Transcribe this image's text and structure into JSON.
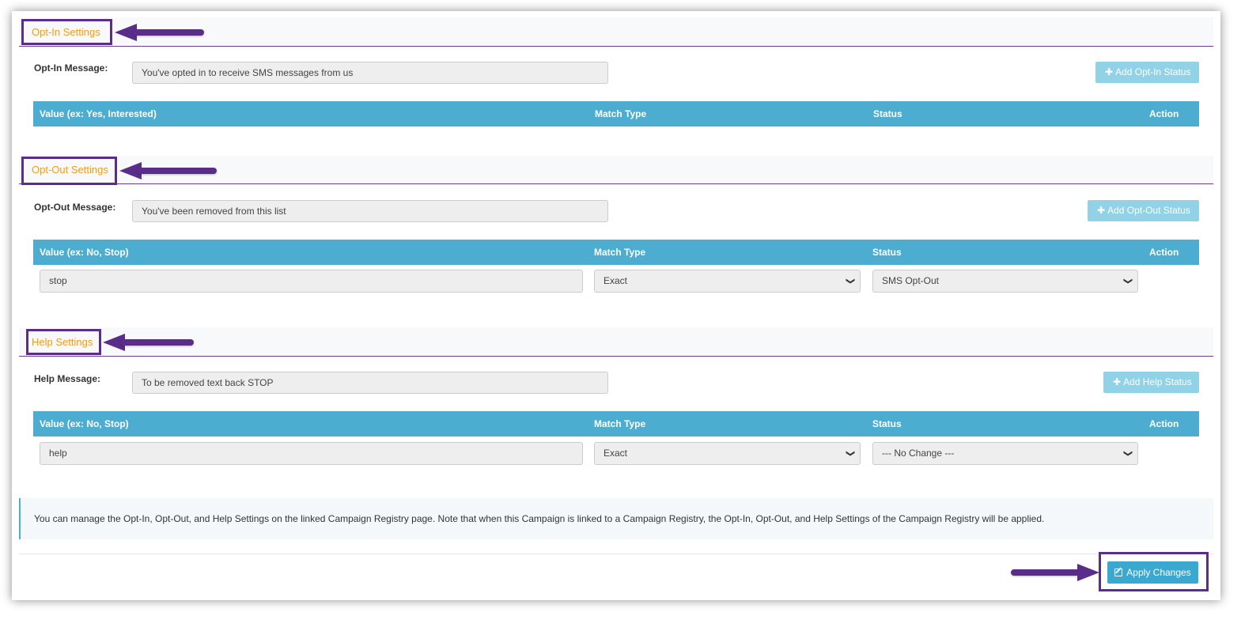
{
  "opt_in": {
    "title": "Opt-In Settings",
    "message_label": "Opt-In Message:",
    "message_value": "You've opted in to receive SMS messages from us",
    "add_button": "Add Opt-In Status",
    "columns": [
      "Value (ex: Yes, Interested)",
      "Match Type",
      "Status",
      "Action"
    ],
    "rows": []
  },
  "opt_out": {
    "title": "Opt-Out Settings",
    "message_label": "Opt-Out Message:",
    "message_value": "You've been removed from this list",
    "add_button": "Add Opt-Out Status",
    "columns": [
      "Value (ex: No, Stop)",
      "Match Type",
      "Status",
      "Action"
    ],
    "rows": [
      {
        "value": "stop",
        "match_type": "Exact",
        "status": "SMS Opt-Out"
      }
    ]
  },
  "help": {
    "title": "Help Settings",
    "message_label": "Help Message:",
    "message_value": "To be removed text back STOP",
    "add_button": "Add Help Status",
    "columns": [
      "Value (ex: No, Stop)",
      "Match Type",
      "Status",
      "Action"
    ],
    "rows": [
      {
        "value": "help",
        "match_type": "Exact",
        "status": "--- No Change ---"
      }
    ]
  },
  "note": "You can manage the Opt-In, Opt-Out, and Help Settings on the linked Campaign Registry page. Note that when this Campaign is linked to a Campaign Registry, the Opt-In, Opt-Out, and Help Settings of the Campaign Registry will be applied.",
  "footer": {
    "apply_button": "Apply Changes"
  },
  "colors": {
    "section_title": "#f39c12",
    "table_header": "#4cadd0",
    "add_button": "#91d2e6",
    "apply_button": "#3aa8cf",
    "highlight": "#5b2d8b"
  },
  "icons": {
    "add": "plus-icon",
    "apply": "edit-icon",
    "select": "chevron-down-icon"
  }
}
